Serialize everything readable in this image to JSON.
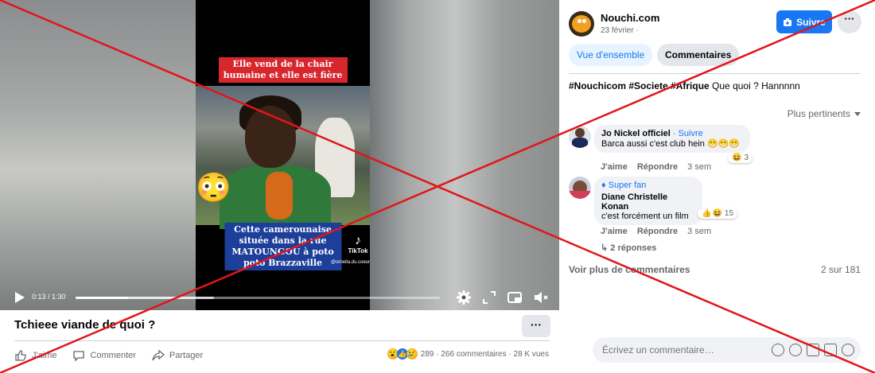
{
  "video": {
    "caption_top": "Elle vend de la chair humaine et elle est fière",
    "caption_bottom": "Cette camerounaise située dans la rue MATOUNGOU à poto poto Brazzaville",
    "tiktok_brand": "TikTok",
    "tiktok_handle": "@ornella.du.coeur",
    "time": "0:13 / 1:30",
    "progress_fraction": 0.144,
    "buffer_fraction": 0.38
  },
  "post": {
    "title": "Tchieee viande de quoi ?",
    "more_label": "···",
    "actions": {
      "like": "J'aime",
      "comment": "Commenter",
      "share": "Partager"
    },
    "stats": {
      "reactions": "289",
      "comments": "266 commentaires",
      "views": "28 K vues"
    }
  },
  "sidebar": {
    "page_name": "Nouchi.com",
    "date": "23 février ·",
    "follow_label": "Suivre",
    "more_label": "···",
    "tabs": [
      "Vue d'ensemble",
      "Commentaires"
    ],
    "post_hashtags": "#Nouchicom #Societe #Afrique",
    "post_text": " Que quoi ? Hannnnn",
    "sort_label": "Plus pertinents",
    "comments": [
      {
        "name": "Jo Nickel officiel",
        "follow": " · Suivre",
        "text": "Barca aussi c'est club hein 😁😁😁",
        "like": "J'aime",
        "reply": "Répondre",
        "time": "3 sem",
        "reactions": "3"
      },
      {
        "badge": "♦ Super fan",
        "name": "Diane Christelle Konan",
        "text": "c'est forcément un film",
        "like": "J'aime",
        "reply": "Répondre",
        "time": "3 sem",
        "reactions": "15"
      }
    ],
    "replies_label": "↳ 2 réponses",
    "more_comments": "Voir plus de commentaires",
    "comments_count": "2 sur 181",
    "input_placeholder": "Écrivez un commentaire…"
  },
  "colors": {
    "accent": "#1877f2",
    "x_mark": "#e0161b"
  }
}
